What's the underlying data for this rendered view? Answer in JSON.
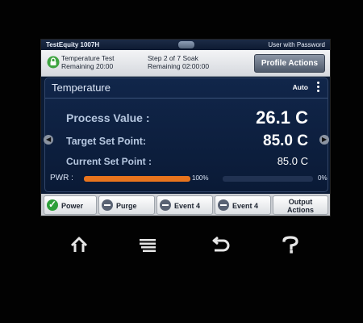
{
  "status_bar": {
    "model": "TestEquity 1007H",
    "user": "User with Password"
  },
  "profile": {
    "test_name": "Temperature Test",
    "test_remaining": "Remaining 20:00",
    "step": "Step 2 of 7 Soak",
    "step_remaining": "Remaining 02:00:00",
    "actions_label": "Profile Actions"
  },
  "panel": {
    "title": "Temperature",
    "mode": "Auto",
    "process_value_label": "Process Value :",
    "process_value": "26.1 C",
    "target_set_point_label": "Target Set Point:",
    "target_set_point": "85.0 C",
    "current_set_point_label": "Current Set Point :",
    "current_set_point": "85.0 C",
    "pwr_label": "PWR :",
    "pwr_heat_pct_text": "100%",
    "pwr_heat_fraction": 1.0,
    "pwr_cool_pct_text": "0%",
    "pwr_cool_fraction": 0.0
  },
  "bottom_buttons": [
    {
      "label": "Power",
      "icon": "check-icon"
    },
    {
      "label": "Purge",
      "icon": "minus-icon"
    },
    {
      "label": "Event 4",
      "icon": "minus-icon"
    },
    {
      "label": "Event 4",
      "icon": "minus-icon"
    },
    {
      "label_line1": "Output",
      "label_line2": "Actions"
    }
  ],
  "hardware_keys": [
    "home-icon",
    "menu-icon",
    "back-icon",
    "help-icon"
  ],
  "colors": {
    "accent_orange": "#e8741d",
    "ok_green": "#2e9f3a",
    "panel_blue": "#0a1a36"
  }
}
